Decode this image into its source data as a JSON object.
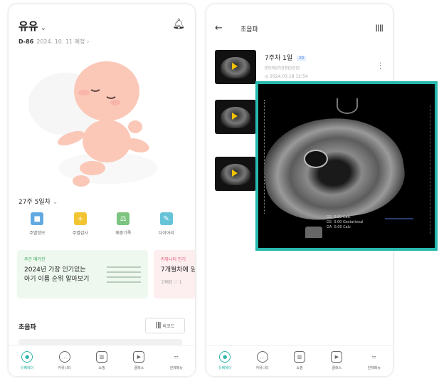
{
  "left_screen": {
    "header": {
      "name": "유유",
      "dday": "D-86",
      "due_date": "2024. 10. 11 예정"
    },
    "week_label": "27주 5일차",
    "menu": [
      {
        "label": "주별정보",
        "icon": "info-book-icon",
        "color": "#63a9e0"
      },
      {
        "label": "주별검사",
        "icon": "checkup-icon",
        "color": "#f2c431"
      },
      {
        "label": "체중기록",
        "icon": "scale-icon",
        "color": "#7cc47f"
      },
      {
        "label": "다이어리",
        "icon": "diary-icon",
        "color": "#66c3d8"
      }
    ],
    "cards": [
      {
        "tag": "주간 매거진",
        "title": "2024년 가장 인기있는\n아기 이름 순위 알아보기",
        "tag_color": "#37a65a"
      },
      {
        "tag": "커뮤니티 인기",
        "title": "7개월차에 임",
        "sub": "고배요 ♡ 1",
        "tag_color": "#e0546b"
      }
    ],
    "ultrasound_section": {
      "title": "초음파",
      "barcode_label": "바코드"
    },
    "tabs": [
      {
        "label": "유삐메이",
        "icon": "home-icon",
        "active": true
      },
      {
        "label": "커뮤니티",
        "icon": "chat-icon",
        "active": false
      },
      {
        "label": "쇼핑",
        "icon": "shop-icon",
        "active": false
      },
      {
        "label": "클래스",
        "icon": "play-icon",
        "active": false
      },
      {
        "label": "전체메뉴",
        "icon": "grid-icon",
        "active": false
      }
    ]
  },
  "right_screen": {
    "header": {
      "title": "초음파",
      "back": "←",
      "barcode": "||||"
    },
    "videos": [
      {
        "title": "7주차 1일",
        "badge": "2D",
        "hospital": "분당제일여성병원(본원)",
        "date": "◎ 2024.03.18 12:54"
      },
      {
        "title": "",
        "badge": "",
        "hospital": "",
        "date": ""
      },
      {
        "title": "",
        "badge": "",
        "hospital": "",
        "date": ""
      }
    ],
    "tabs": [
      {
        "label": "유삐메이",
        "icon": "home-icon",
        "active": true
      },
      {
        "label": "커뮤니티",
        "icon": "chat-icon",
        "active": false
      },
      {
        "label": "쇼핑",
        "icon": "shop-icon",
        "active": false
      },
      {
        "label": "클래스",
        "icon": "play-icon",
        "active": false
      },
      {
        "label": "전체메뉴",
        "icon": "grid-icon",
        "active": false
      }
    ]
  },
  "popup": {
    "border_color": "#27b8ad",
    "caption": "GS  0.00 Calc\nGS  0.00 Gestational\nGA  0.00 Calc"
  },
  "colors": {
    "accent": "#2bb3a6"
  }
}
